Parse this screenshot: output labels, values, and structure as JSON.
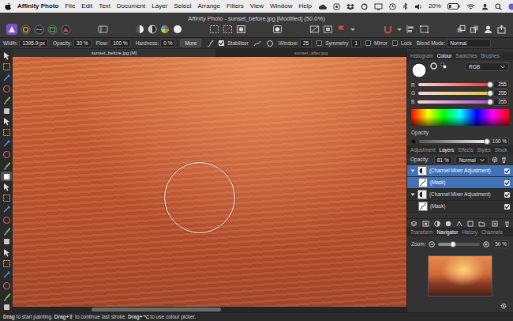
{
  "menubar": {
    "app": "Affinity Photo",
    "menus": [
      "File",
      "Edit",
      "Text",
      "Document",
      "Layer",
      "Select",
      "Arrange",
      "Filters",
      "View",
      "Window",
      "Help"
    ],
    "battery": "20%"
  },
  "window": {
    "title": "Affinity Photo - sunset_before.jpg [Modified] (50.0%)"
  },
  "context_toolbar": [
    {
      "kind": "field",
      "label": "Width:",
      "value": "1395.9 px"
    },
    {
      "kind": "field",
      "label": "Opacity:",
      "value": "30 %"
    },
    {
      "kind": "field",
      "label": "Flow:",
      "value": "100 %"
    },
    {
      "kind": "field",
      "label": "Hardness:",
      "value": "0 %"
    },
    {
      "kind": "button",
      "label": "More"
    },
    {
      "kind": "check",
      "label": "Stabiliser",
      "checked": true
    },
    {
      "kind": "field",
      "label": "Window:",
      "value": "25"
    },
    {
      "kind": "check",
      "label": "Symmetry",
      "checked": false,
      "value": "1"
    },
    {
      "kind": "check",
      "label": "Mirror",
      "checked": false
    },
    {
      "kind": "check",
      "label": "Lock",
      "checked": false
    },
    {
      "kind": "dropdown",
      "label": "Blend Mode:",
      "value": "Normal"
    }
  ],
  "tools": [
    {
      "selected": false
    },
    {
      "selected": false
    },
    {
      "selected": false
    },
    {
      "selected": false
    },
    {
      "selected": false
    },
    {
      "selected": false
    },
    {
      "selected": false
    },
    {
      "selected": false
    },
    {
      "selected": false
    },
    {
      "selected": false
    },
    {
      "selected": false
    },
    {
      "selected": true
    },
    {
      "selected": false
    },
    {
      "selected": false
    },
    {
      "selected": false
    },
    {
      "selected": false
    },
    {
      "selected": false
    },
    {
      "selected": false
    },
    {
      "selected": false
    },
    {
      "selected": false
    },
    {
      "selected": false
    },
    {
      "selected": false
    },
    {
      "selected": false
    },
    {
      "selected": false
    }
  ],
  "document_tabs": [
    {
      "label": "sunset_before.jpg [M]",
      "selected": true
    },
    {
      "label": "sunset_after.jpg",
      "selected": false
    }
  ],
  "canvas_scroll": {
    "level": 0.55
  },
  "colour_panel": {
    "tabs": [
      {
        "label": "Histogram",
        "selected": false
      },
      {
        "label": "Colour",
        "selected": true
      },
      {
        "label": "Swatches",
        "selected": false
      },
      {
        "label": "Brushes",
        "selected": false
      }
    ],
    "fill_color": "#ffffff",
    "model": "RGB",
    "channels": [
      {
        "label": "R",
        "value": "255",
        "level": 1,
        "color": "#e8383a"
      },
      {
        "label": "G",
        "value": "255",
        "level": 1,
        "color": "#e8c838"
      },
      {
        "label": "B",
        "value": "255",
        "level": 1,
        "color": "#b050e0"
      }
    ],
    "opacity": {
      "label": "Opacity",
      "value": "100 %",
      "level": 1
    }
  },
  "layers_panel": {
    "tabs": [
      {
        "label": "Adjustment",
        "selected": false
      },
      {
        "label": "Layers",
        "selected": true
      },
      {
        "label": "Effects",
        "selected": false
      },
      {
        "label": "Styles",
        "selected": false
      },
      {
        "label": "Stock",
        "selected": false
      }
    ],
    "opacity_label": "Opacity:",
    "opacity_value": "81 %",
    "blend_mode": "Normal",
    "layers": [
      {
        "kind": "adjustment",
        "name": "(Channel Mixer Adjustment)",
        "selected": true,
        "visible": true,
        "expanded": true
      },
      {
        "kind": "mask",
        "name": "(Mask)",
        "selected": true,
        "visible": true
      },
      {
        "kind": "adjustment",
        "name": "(Channel Mixer Adjustment)",
        "selected": false,
        "visible": true,
        "expanded": true
      },
      {
        "kind": "mask",
        "name": "(Mask)",
        "selected": false,
        "visible": true
      }
    ]
  },
  "navigator_panel": {
    "tabs": [
      {
        "label": "Transform",
        "selected": false
      },
      {
        "label": "Navigator",
        "selected": true
      },
      {
        "label": "History",
        "selected": false
      },
      {
        "label": "Channels",
        "selected": false
      }
    ],
    "zoom_label": "Zoom:",
    "zoom_value": "50 %",
    "zoom_level": 0.35
  },
  "status_bar": [
    {
      "text": "Drag",
      "bold": true
    },
    {
      "text": " to start painting. ",
      "bold": false
    },
    {
      "text": "Drag+⇧",
      "bold": true
    },
    {
      "text": " to continue last stroke. ",
      "bold": false
    },
    {
      "text": "Drag+⌥",
      "bold": true
    },
    {
      "text": " to use colour picker.",
      "bold": false
    }
  ]
}
